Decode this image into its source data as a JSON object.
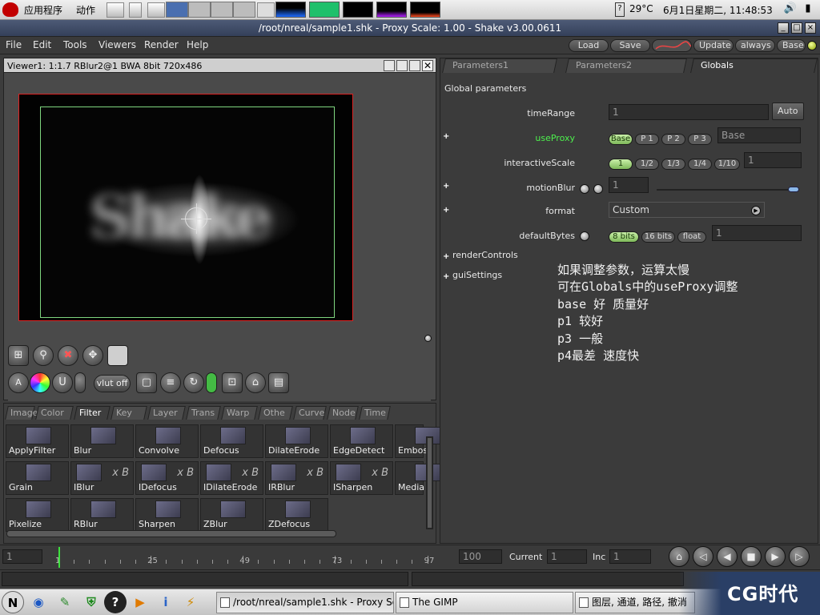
{
  "top_panel": {
    "applications_menu": "应用程序",
    "actions_menu": "动作",
    "weather": "29°C",
    "clock": "6月1日星期二, 11:48:53"
  },
  "window": {
    "title": "/root/nreal/sample1.shk - Proxy Scale: 1.00 - Shake v3.00.0611",
    "btn_min": "_",
    "btn_max": "□",
    "btn_close": "×"
  },
  "menubar": {
    "items": [
      "File",
      "Edit",
      "Tools",
      "Viewers",
      "Render",
      "Help"
    ],
    "load": "Load",
    "save": "Save",
    "update": "Update",
    "always": "always",
    "base": "Base"
  },
  "viewer": {
    "header": "Viewer1: 1:1.7 RBlur2@1 BWA 8bit 720x486",
    "vlut": "vlut off"
  },
  "tool_tabs": [
    "Image",
    "Color",
    "Filter",
    "Key",
    "Layer",
    "Trans",
    "Warp",
    "Othe",
    "Curve",
    "Node",
    "Time"
  ],
  "active_tool_tab": "Filter",
  "filter_nodes": [
    [
      "ApplyFilter",
      "Blur",
      "Convolve",
      "Defocus",
      "DilateErode",
      "EdgeDetect",
      "Embos"
    ],
    [
      "Grain",
      "IBlur",
      "IDefocus",
      "IDilateErode",
      "IRBlur",
      "ISharpen",
      "Media"
    ],
    [
      "Pixelize",
      "RBlur",
      "Sharpen",
      "ZBlur",
      "ZDefocus"
    ]
  ],
  "xb_label": "x B",
  "params": {
    "tabs": [
      "Parameters1",
      "Parameters2",
      "Globals"
    ],
    "section": "Global parameters",
    "time_range_label": "timeRange",
    "time_range_value": "1",
    "auto": "Auto",
    "use_proxy_label": "useProxy",
    "use_proxy_options": [
      "Base",
      "P 1",
      "P 2",
      "P 3"
    ],
    "use_proxy_value": "Base",
    "interactive_scale_label": "interactiveScale",
    "interactive_scale_options": [
      "1",
      "1/2",
      "1/3",
      "1/4",
      "1/10"
    ],
    "interactive_scale_value": "1",
    "motion_blur_label": "motionBlur",
    "motion_blur_value": "1",
    "format_label": "format",
    "format_value": "Custom",
    "default_bytes_label": "defaultBytes",
    "default_bytes_options": [
      "8 bits",
      "16 bits",
      "float"
    ],
    "default_bytes_value": "1",
    "render_controls": "renderControls",
    "gui_settings": "guiSettings",
    "note_lines": [
      "如果调整参数，运算太慢",
      "可在Globals中的useProxy调整",
      "base 好 质量好",
      "p1 较好",
      "p3 一般",
      "p4最差  速度快"
    ]
  },
  "timebar": {
    "start": "1",
    "ticks": [
      "1",
      "25",
      "49",
      "73",
      "97"
    ],
    "end": "100",
    "current_label": "Current",
    "current_value": "1",
    "inc_label": "Inc",
    "inc_value": "1"
  },
  "taskbar": {
    "tasks": [
      "/root/nreal/sample1.shk - Proxy Sc",
      "The GIMP",
      "图层, 通道, 路径, 撤消"
    ],
    "watermark": "CG时代"
  }
}
